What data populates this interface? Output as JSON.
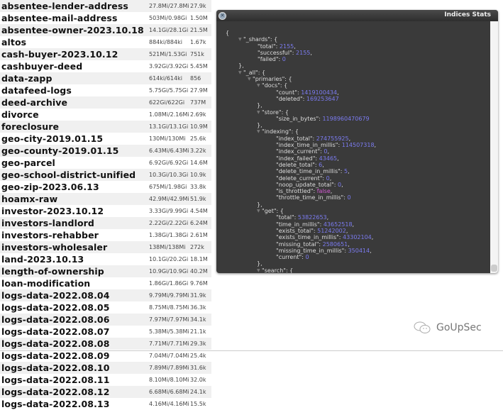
{
  "indices": [
    {
      "name": "absentee-lender-address",
      "size": "27.8Mi/27.8Mi",
      "docs": "27.9k"
    },
    {
      "name": "absentee-mail-address",
      "size": "503Mi/0.98Gi",
      "docs": "1.50M"
    },
    {
      "name": "absentee-owner-2023.10.18",
      "size": "14.1Gi/28.1Gi",
      "docs": "21.5M"
    },
    {
      "name": "altos",
      "size": "884ki/884ki",
      "docs": "1.67k"
    },
    {
      "name": "cash-buyer-2023.10.12",
      "size": "521Mi/1.53Gi",
      "docs": "751k"
    },
    {
      "name": "cashbuyer-deed",
      "size": "3.92Gi/3.92Gi",
      "docs": "5.45M"
    },
    {
      "name": "data-zapp",
      "size": "614ki/614ki",
      "docs": "856"
    },
    {
      "name": "datafeed-logs",
      "size": "5.75Gi/5.75Gi",
      "docs": "27.9M"
    },
    {
      "name": "deed-archive",
      "size": "622Gi/622Gi",
      "docs": "737M"
    },
    {
      "name": "divorce",
      "size": "1.08Mi/2.16Mi",
      "docs": "2.69k"
    },
    {
      "name": "foreclosure",
      "size": "13.1Gi/13.1Gi",
      "docs": "10.9M"
    },
    {
      "name": "geo-city-2019.01.15",
      "size": "130Mi/130Mi",
      "docs": "25.6k"
    },
    {
      "name": "geo-county-2019.01.15",
      "size": "6.43Mi/6.43Mi",
      "docs": "3.22k"
    },
    {
      "name": "geo-parcel",
      "size": "6.92Gi/6.92Gi",
      "docs": "14.6M"
    },
    {
      "name": "geo-school-district-unified",
      "size": "10.3Gi/10.3Gi",
      "docs": "10.9k"
    },
    {
      "name": "geo-zip-2023.06.13",
      "size": "675Mi/1.98Gi",
      "docs": "33.8k"
    },
    {
      "name": "hoamx-raw",
      "size": "42.9Mi/42.9Mi",
      "docs": "51.9k"
    },
    {
      "name": "investor-2023.10.12",
      "size": "3.33Gi/9.99Gi",
      "docs": "4.54M"
    },
    {
      "name": "investors-landlord",
      "size": "2.22Gi/2.22Gi",
      "docs": "6.24M"
    },
    {
      "name": "investors-rehabber",
      "size": "1.38Gi/1.38Gi",
      "docs": "2.61M"
    },
    {
      "name": "investors-wholesaler",
      "size": "138Mi/138Mi",
      "docs": "272k"
    },
    {
      "name": "land-2023.10.13",
      "size": "10.1Gi/20.2Gi",
      "docs": "18.1M"
    },
    {
      "name": "length-of-ownership",
      "size": "10.9Gi/10.9Gi",
      "docs": "40.2M"
    },
    {
      "name": "loan-modification",
      "size": "1.86Gi/1.86Gi",
      "docs": "9.76M"
    },
    {
      "name": "logs-data-2022.08.04",
      "size": "9.79Mi/9.79Mi",
      "docs": "31.9k"
    },
    {
      "name": "logs-data-2022.08.05",
      "size": "8.75Mi/8.75Mi",
      "docs": "36.3k"
    },
    {
      "name": "logs-data-2022.08.06",
      "size": "7.97Mi/7.97Mi",
      "docs": "34.1k"
    },
    {
      "name": "logs-data-2022.08.07",
      "size": "5.38Mi/5.38Mi",
      "docs": "21.1k"
    },
    {
      "name": "logs-data-2022.08.08",
      "size": "7.71Mi/7.71Mi",
      "docs": "29.3k"
    },
    {
      "name": "logs-data-2022.08.09",
      "size": "7.04Mi/7.04Mi",
      "docs": "25.4k"
    },
    {
      "name": "logs-data-2022.08.10",
      "size": "7.89Mi/7.89Mi",
      "docs": "31.6k"
    },
    {
      "name": "logs-data-2022.08.11",
      "size": "8.10Mi/8.10Mi",
      "docs": "32.0k"
    },
    {
      "name": "logs-data-2022.08.12",
      "size": "6.68Mi/6.68Mi",
      "docs": "24.1k"
    },
    {
      "name": "logs-data-2022.08.13",
      "size": "4.16Mi/4.16Mi",
      "docs": "15.5k"
    }
  ],
  "panel": {
    "title": "Indices Stats",
    "lines": [
      {
        "d": 0,
        "t": "{"
      },
      {
        "d": 1,
        "k": "_shards",
        "o": true
      },
      {
        "d": 2,
        "k": "total",
        "v": "2155",
        "c": true
      },
      {
        "d": 2,
        "k": "successful",
        "v": "2155",
        "c": true
      },
      {
        "d": 2,
        "k": "failed",
        "v": "0"
      },
      {
        "d": 1,
        "t": "},"
      },
      {
        "d": 1,
        "k": "_all",
        "o": true
      },
      {
        "d": 2,
        "k": "primaries",
        "o": true
      },
      {
        "d": 3,
        "k": "docs",
        "o": true
      },
      {
        "d": 4,
        "k": "count",
        "v": "1419100434",
        "c": true
      },
      {
        "d": 4,
        "k": "deleted",
        "v": "169253647"
      },
      {
        "d": 3,
        "t": "},"
      },
      {
        "d": 3,
        "k": "store",
        "o": true
      },
      {
        "d": 4,
        "k": "size_in_bytes",
        "v": "1198960470679"
      },
      {
        "d": 3,
        "t": "},"
      },
      {
        "d": 3,
        "k": "indexing",
        "o": true
      },
      {
        "d": 4,
        "k": "index_total",
        "v": "274755925",
        "c": true
      },
      {
        "d": 4,
        "k": "index_time_in_millis",
        "v": "114507318",
        "c": true
      },
      {
        "d": 4,
        "k": "index_current",
        "v": "0",
        "c": true
      },
      {
        "d": 4,
        "k": "index_failed",
        "v": "43465",
        "c": true
      },
      {
        "d": 4,
        "k": "delete_total",
        "v": "6",
        "c": true
      },
      {
        "d": 4,
        "k": "delete_time_in_millis",
        "v": "5",
        "c": true
      },
      {
        "d": 4,
        "k": "delete_current",
        "v": "0",
        "c": true
      },
      {
        "d": 4,
        "k": "noop_update_total",
        "v": "0",
        "c": true
      },
      {
        "d": 4,
        "k": "is_throttled",
        "v": "false",
        "c": true,
        "b": true
      },
      {
        "d": 4,
        "k": "throttle_time_in_millis",
        "v": "0"
      },
      {
        "d": 3,
        "t": "},"
      },
      {
        "d": 3,
        "k": "get",
        "o": true
      },
      {
        "d": 4,
        "k": "total",
        "v": "53822653",
        "c": true
      },
      {
        "d": 4,
        "k": "time_in_millis",
        "v": "43652518",
        "c": true
      },
      {
        "d": 4,
        "k": "exists_total",
        "v": "51242002",
        "c": true
      },
      {
        "d": 4,
        "k": "exists_time_in_millis",
        "v": "43302104",
        "c": true
      },
      {
        "d": 4,
        "k": "missing_total",
        "v": "2580651",
        "c": true
      },
      {
        "d": 4,
        "k": "missing_time_in_millis",
        "v": "350414",
        "c": true
      },
      {
        "d": 4,
        "k": "current",
        "v": "0"
      },
      {
        "d": 3,
        "t": "},"
      },
      {
        "d": 3,
        "k": "search",
        "o": true
      }
    ]
  },
  "watermark": "GoUpSec"
}
